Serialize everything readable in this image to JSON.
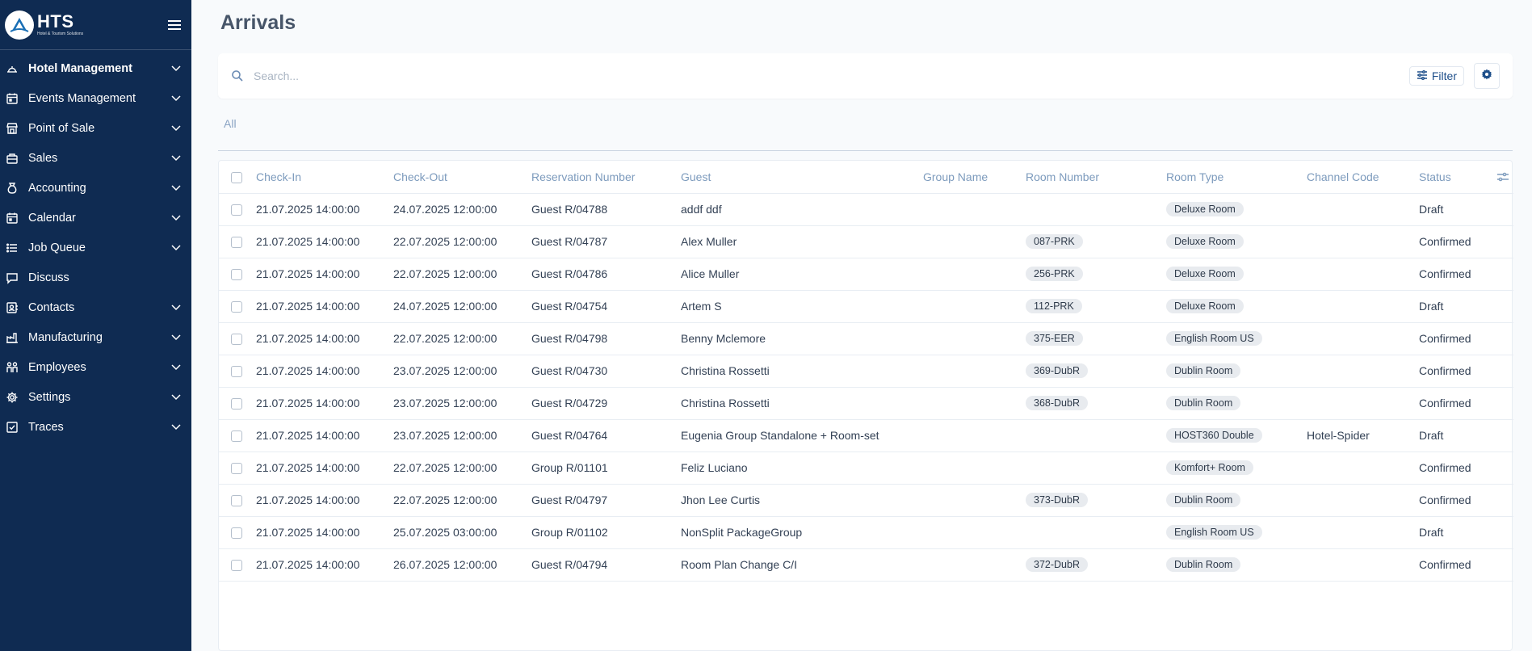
{
  "brand": {
    "name": "HTS",
    "subtitle": "Hotel & Tourism Solutions"
  },
  "sidebar": {
    "items": [
      {
        "label": "Hotel Management",
        "icon": "bell-icon",
        "expandable": true,
        "active": true
      },
      {
        "label": "Events Management",
        "icon": "calendar-icon",
        "expandable": true
      },
      {
        "label": "Point of Sale",
        "icon": "store-icon",
        "expandable": true
      },
      {
        "label": "Sales",
        "icon": "sales-icon",
        "expandable": true
      },
      {
        "label": "Accounting",
        "icon": "money-bag-icon",
        "expandable": true
      },
      {
        "label": "Calendar",
        "icon": "calendar-icon",
        "expandable": true
      },
      {
        "label": "Job Queue",
        "icon": "list-icon",
        "expandable": true
      },
      {
        "label": "Discuss",
        "icon": "chat-icon",
        "expandable": false
      },
      {
        "label": "Contacts",
        "icon": "contacts-icon",
        "expandable": true
      },
      {
        "label": "Manufacturing",
        "icon": "factory-icon",
        "expandable": true
      },
      {
        "label": "Employees",
        "icon": "people-icon",
        "expandable": true
      },
      {
        "label": "Settings",
        "icon": "gear-icon",
        "expandable": true
      },
      {
        "label": "Traces",
        "icon": "checkbox-icon",
        "expandable": true
      }
    ]
  },
  "page": {
    "title": "Arrivals"
  },
  "search": {
    "placeholder": "Search...",
    "value": ""
  },
  "toolbar": {
    "filter_label": "Filter"
  },
  "tabs": [
    {
      "label": "All"
    }
  ],
  "table": {
    "columns": [
      "Check-In",
      "Check-Out",
      "Reservation Number",
      "Guest",
      "Group Name",
      "Room Number",
      "Room Type",
      "Channel Code",
      "Status"
    ],
    "rows": [
      {
        "check_in": "21.07.2025 14:00:00",
        "check_out": "24.07.2025 12:00:00",
        "reservation": "Guest R/04788",
        "guest": "addf ddf",
        "group": "",
        "room_number": "",
        "room_type": "Deluxe Room",
        "channel": "",
        "status": "Draft"
      },
      {
        "check_in": "21.07.2025 14:00:00",
        "check_out": "22.07.2025 12:00:00",
        "reservation": "Guest R/04787",
        "guest": "Alex Muller",
        "group": "",
        "room_number": "087-PRK",
        "room_type": "Deluxe Room",
        "channel": "",
        "status": "Confirmed"
      },
      {
        "check_in": "21.07.2025 14:00:00",
        "check_out": "22.07.2025 12:00:00",
        "reservation": "Guest R/04786",
        "guest": "Alice Muller",
        "group": "",
        "room_number": "256-PRK",
        "room_type": "Deluxe Room",
        "channel": "",
        "status": "Confirmed"
      },
      {
        "check_in": "21.07.2025 14:00:00",
        "check_out": "24.07.2025 12:00:00",
        "reservation": "Guest R/04754",
        "guest": "Artem S",
        "group": "",
        "room_number": "112-PRK",
        "room_type": "Deluxe Room",
        "channel": "",
        "status": "Draft"
      },
      {
        "check_in": "21.07.2025 14:00:00",
        "check_out": "22.07.2025 12:00:00",
        "reservation": "Guest R/04798",
        "guest": "Benny Mclemore",
        "group": "",
        "room_number": "375-EER",
        "room_type": "English Room US",
        "channel": "",
        "status": "Confirmed"
      },
      {
        "check_in": "21.07.2025 14:00:00",
        "check_out": "23.07.2025 12:00:00",
        "reservation": "Guest R/04730",
        "guest": "Christina Rossetti",
        "group": "",
        "room_number": "369-DubR",
        "room_type": "Dublin Room",
        "channel": "",
        "status": "Confirmed"
      },
      {
        "check_in": "21.07.2025 14:00:00",
        "check_out": "23.07.2025 12:00:00",
        "reservation": "Guest R/04729",
        "guest": "Christina Rossetti",
        "group": "",
        "room_number": "368-DubR",
        "room_type": "Dublin Room",
        "channel": "",
        "status": "Confirmed"
      },
      {
        "check_in": "21.07.2025 14:00:00",
        "check_out": "23.07.2025 12:00:00",
        "reservation": "Guest R/04764",
        "guest": "Eugenia Group Standalone + Room-set",
        "group": "",
        "room_number": "",
        "room_type": "HOST360 Double",
        "channel": "Hotel-Spider",
        "status": "Draft"
      },
      {
        "check_in": "21.07.2025 14:00:00",
        "check_out": "22.07.2025 12:00:00",
        "reservation": "Group R/01101",
        "guest": "Feliz Luciano",
        "group": "",
        "room_number": "",
        "room_type": "Komfort+ Room",
        "channel": "",
        "status": "Confirmed"
      },
      {
        "check_in": "21.07.2025 14:00:00",
        "check_out": "22.07.2025 12:00:00",
        "reservation": "Guest R/04797",
        "guest": "Jhon Lee Curtis",
        "group": "",
        "room_number": "373-DubR",
        "room_type": "Dublin Room",
        "channel": "",
        "status": "Confirmed"
      },
      {
        "check_in": "21.07.2025 14:00:00",
        "check_out": "25.07.2025 03:00:00",
        "reservation": "Group R/01102",
        "guest": "NonSplit PackageGroup",
        "group": "",
        "room_number": "",
        "room_type": "English Room US",
        "channel": "",
        "status": "Draft"
      },
      {
        "check_in": "21.07.2025 14:00:00",
        "check_out": "26.07.2025 12:00:00",
        "reservation": "Guest R/04794",
        "guest": "Room Plan Change C/I",
        "group": "",
        "room_number": "372-DubR",
        "room_type": "Dublin Room",
        "channel": "",
        "status": "Confirmed"
      }
    ]
  },
  "colors": {
    "sidebar_bg": "#0f2b52",
    "accent": "#1e4f8a",
    "header_text": "#7d9bbd",
    "tag_bg": "#e8ebef"
  }
}
